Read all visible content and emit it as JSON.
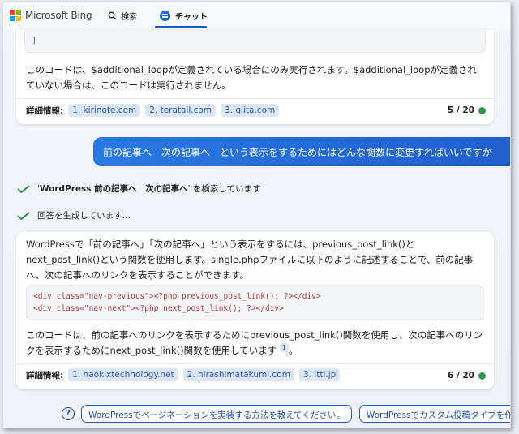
{
  "header": {
    "brand": "Microsoft Bing",
    "tab_search": "検索",
    "tab_chat": "チャット"
  },
  "previous_answer": {
    "code_tail": "]",
    "text": "このコードは、$additional_loopが定義されている場合にのみ実行されます。$additional_loopが定義されていない場合は、このコードは実行されません。",
    "sources_label": "詳細情報:",
    "sources": [
      "1. kirinote.com",
      "2. teratail.com",
      "3. qiita.com"
    ],
    "counter": "5 / 20"
  },
  "user_message": "前の記事へ　次の記事へ　という表示をするためにはどんな関数に変更すればいいですか",
  "status": {
    "searching_query": "WordPress 前の記事へ　次の記事へ",
    "searching_suffix": "を検索しています",
    "generating": "回答を生成しています…"
  },
  "answer": {
    "para1": "WordPressで「前の記事へ」「次の記事へ」という表示をするには、previous_post_link()とnext_post_link()という関数を使用します。single.phpファイルに以下のように記述することで、前の記事へ、次の記事へのリンクを表示することができます。",
    "code_line1": "<div class=\"nav-previous\"><?php previous_post_link(); ?></div>",
    "code_line2": "<div class=\"nav-next\"><?php next_post_link(); ?></div>",
    "para2": "このコードは、前の記事へのリンクを表示するためにprevious_post_link()関数を使用し、次の記事へのリンクを表示するためにnext_post_link()関数を使用しています",
    "para2_ref": "1",
    "para2_end": "。",
    "sources_label": "詳細情報:",
    "sources": [
      "1. naokixtechnology.net",
      "2. hirashimatakumi.com",
      "3. itti.jp"
    ],
    "counter": "6 / 20"
  },
  "suggestions": [
    "WordPressでページネーションを実装する方法を教えてください。",
    "WordPressでカスタム投稿タイプを作"
  ],
  "colors": {
    "accent": "#1f5fce",
    "status_green": "#2e9e44",
    "check_green": "#1e8a3a"
  }
}
